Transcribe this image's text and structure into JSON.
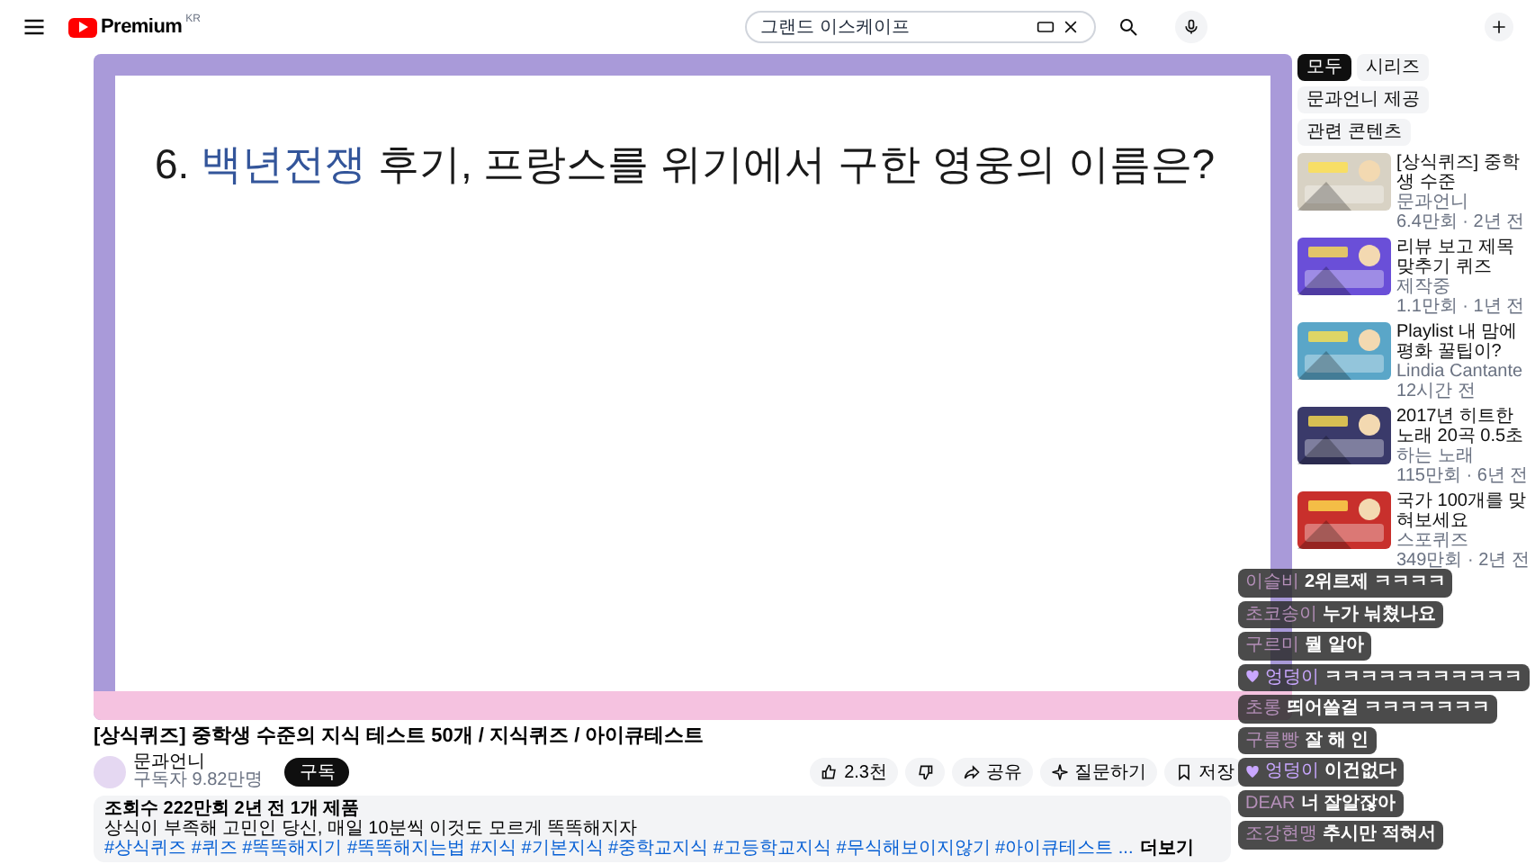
{
  "topbar": {
    "logo_text": "Premium",
    "logo_sup": "KR",
    "search": {
      "value": "그랜드 이스케이프"
    }
  },
  "video": {
    "question": [
      {
        "kind": "plain",
        "text": "6."
      },
      {
        "kind": "highlight",
        "text": "백년전쟁"
      },
      {
        "kind": "plain",
        "text": "후기, 프랑스를 위기에서 구한 영웅의 이름은?"
      }
    ]
  },
  "title": "[상식퀴즈] 중학생 수준의 지식 테스트 50개 / 지식퀴즈 / 아이큐테스트",
  "channel": {
    "name": "문과언니",
    "subscribers": "구독자 9.82만명",
    "subscribe": "구독"
  },
  "actions": [
    {
      "kind": "like",
      "label": "2.3천"
    },
    {
      "kind": "dislike"
    },
    {
      "kind": "share",
      "label": "공유"
    },
    {
      "kind": "ask",
      "label": "질문하기"
    },
    {
      "kind": "save",
      "label": "저장"
    }
  ],
  "description": {
    "meta": "조회수 222만회  2년 전  1개 제품",
    "text": "상식이 부족해 고민인 당신, 매일 10분씩 이것도 모르게 똑똑해지자",
    "hashtags": "#상식퀴즈 #퀴즈 #똑똑해지기 #똑똑해지는법 #지식 #기본지식 #중학교지식 #고등학교지식 #무식해보이지않기 #아이큐테스트 ...",
    "more": "더보기"
  },
  "chips": [
    {
      "label": "모두",
      "selected": true
    },
    {
      "label": "시리즈",
      "selected": false
    },
    {
      "label": "문과언니 제공",
      "selected": false
    },
    {
      "label": "관련 콘텐츠",
      "selected": false
    }
  ],
  "sidebar": [
    {
      "title": "[상식퀴즈] 중학생 수준",
      "channel": "문과언니",
      "meta": "6.4만회 · 2년 전",
      "color": "#d8d2c4"
    },
    {
      "title": "리뷰 보고 제목 맞추기 퀴즈",
      "channel": "제작중",
      "meta": "1.1만회 · 1년 전",
      "color": "#6a4fd8"
    },
    {
      "title": "Playlist 내 맘에 평화 꿀팁이?",
      "channel": "Lindia Cantante",
      "meta": "12시간 전",
      "color": "#5aa6c8"
    },
    {
      "title": "2017년 히트한 노래 20곡 0.5초",
      "channel": "하는 노래",
      "meta": "115만회 · 6년 전",
      "color": "#3a3a6a"
    },
    {
      "title": "국가 100개를 맞혀보세요",
      "channel": "스포퀴즈",
      "meta": "349만회 · 2년 전",
      "color": "#c8302c"
    }
  ],
  "chat": [
    {
      "name": "이슬비",
      "text": "2위르제 ㅋㅋㅋㅋ",
      "heart": false
    },
    {
      "name": "초코송이",
      "text": "누가 눠쳤나요",
      "heart": false
    },
    {
      "name": "구르미",
      "text": "뭘 알아",
      "heart": false
    },
    {
      "name": "엉덩이",
      "text": "ㅋㅋㅋㅋㅋㅋㅋㅋㅋㅋㅋ",
      "heart": true
    },
    {
      "name": "초롱",
      "text": "띄어쓸걸 ㅋㅋㅋㅋㅋㅋㅋ",
      "heart": false
    },
    {
      "name": "구름빵",
      "text": "잘 해 인",
      "heart": false
    },
    {
      "name": "엉덩이",
      "text": "이건없다",
      "heart": true
    },
    {
      "name": "DEAR",
      "text": "너 잘알잖아",
      "heart": false
    },
    {
      "name": "조강현맹",
      "text": "추시만 적혀서",
      "heart": false
    }
  ]
}
